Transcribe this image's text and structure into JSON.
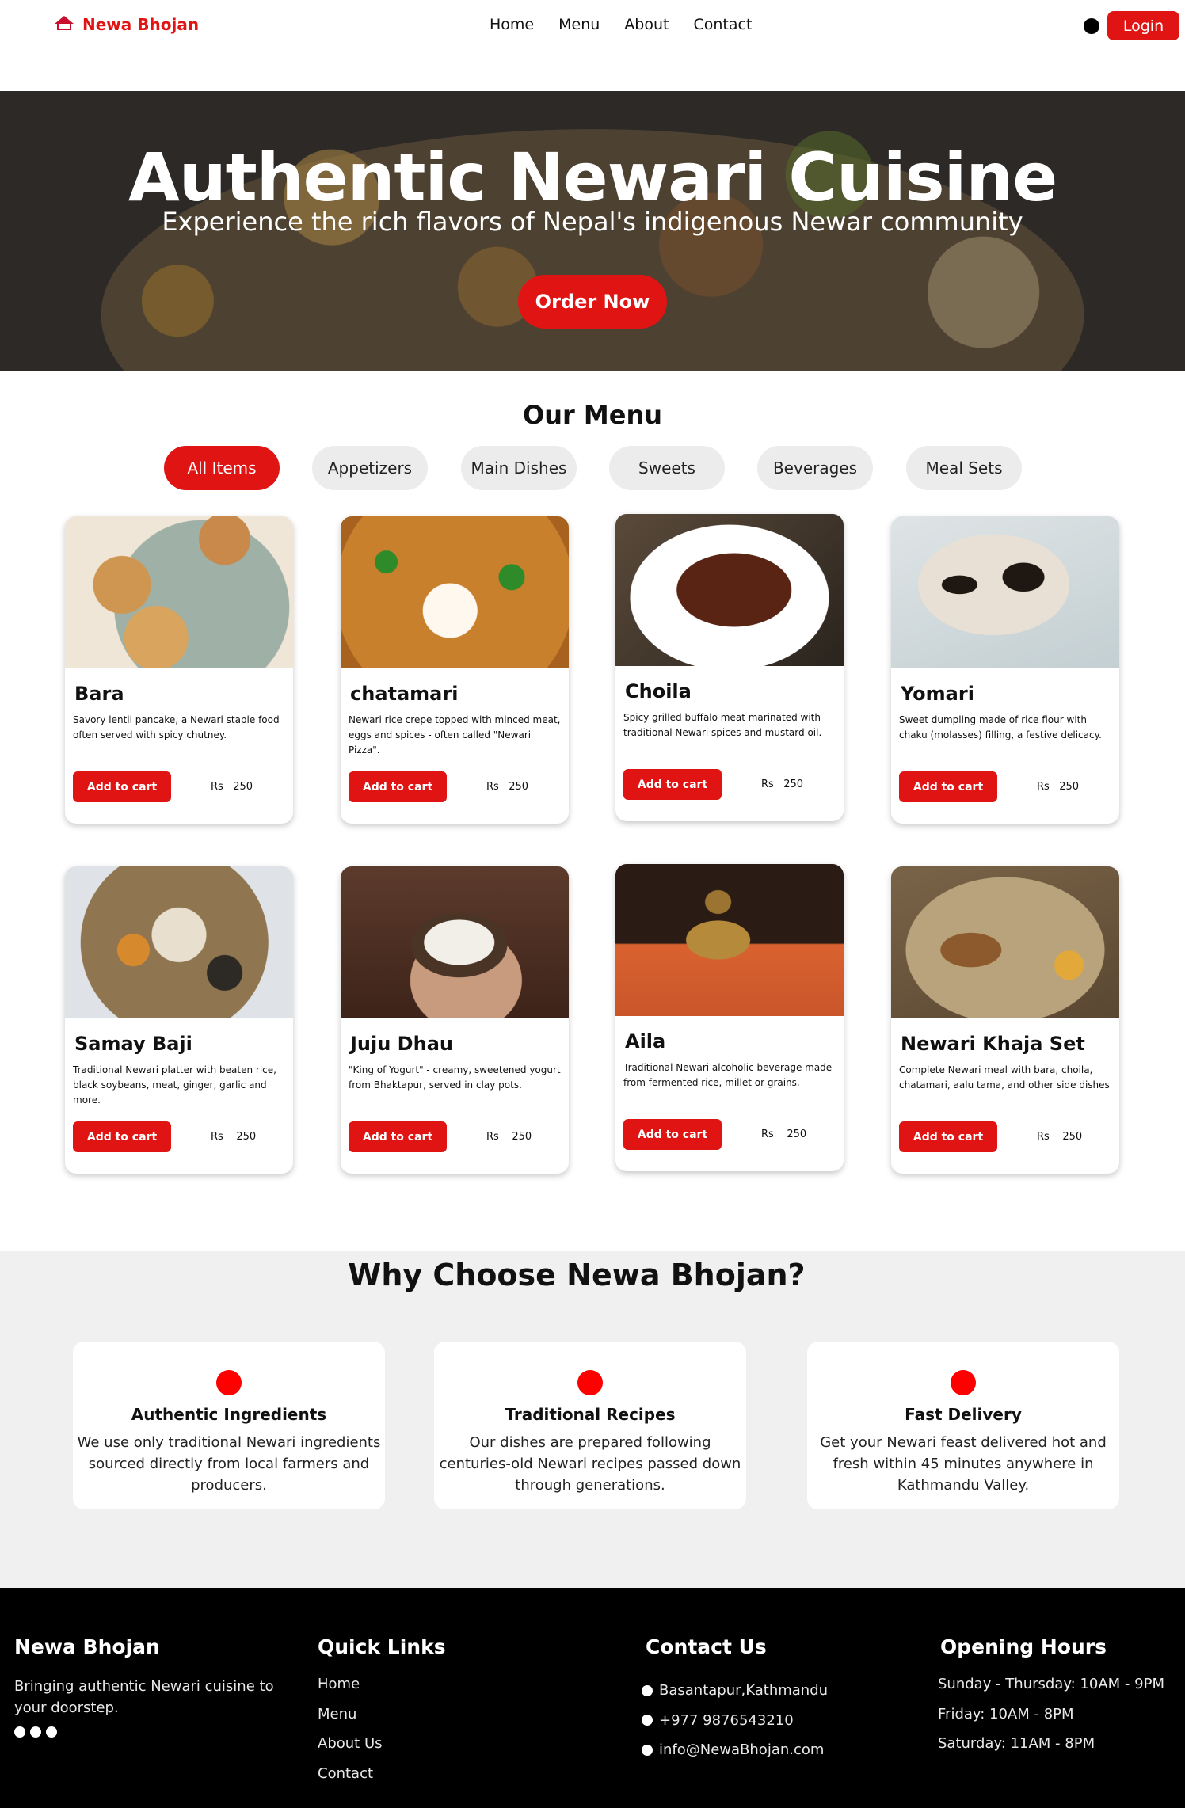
{
  "nav": {
    "brand": "Newa Bhojan",
    "links": [
      "Home",
      "Menu",
      "About",
      "Contact"
    ],
    "login": "Login"
  },
  "hero": {
    "title": "Authentic Newari Cuisine",
    "subtitle": "Experience the rich flavors of Nepal's indigenous Newar community",
    "cta": "Order Now"
  },
  "menu": {
    "title": "Our Menu",
    "filters": [
      "All Items",
      "Appetizers",
      "Main Dishes",
      "Sweets",
      "Beverages",
      "Meal Sets"
    ],
    "active_filter": "All Items",
    "add_label": "Add to cart",
    "items": [
      {
        "name": "Bara",
        "desc": "Savory lentil pancake, a Newari staple food often served with spicy chutney.",
        "price": "Rs   250"
      },
      {
        "name": "chatamari",
        "desc": "Newari rice crepe topped with minced meat, eggs and spices - often called \"Newari Pizza\".",
        "price": "Rs   250"
      },
      {
        "name": "Choila",
        "desc": "Spicy grilled buffalo meat marinated with traditional Newari spices and mustard oil.",
        "price": "Rs   250"
      },
      {
        "name": "Yomari",
        "desc": "Sweet dumpling made of rice flour with chaku (molasses) filling, a festive delicacy.",
        "price": "Rs   250"
      },
      {
        "name": "Samay Baji",
        "desc": "Traditional Newari platter with beaten rice, black soybeans, meat, ginger, garlic and more.",
        "price": "Rs    250"
      },
      {
        "name": "Juju Dhau",
        "desc": "\"King of Yogurt\" - creamy, sweetened yogurt from Bhaktapur, served in clay pots.",
        "price": "Rs    250"
      },
      {
        "name": "Aila",
        "desc": "Traditional Newari alcoholic beverage made from fermented rice, millet or grains.",
        "price": "Rs    250"
      },
      {
        "name": "Newari Khaja Set",
        "desc": "Complete Newari meal with bara, choila, chatamari, aalu tama, and other side dishes",
        "price": "Rs    250"
      }
    ]
  },
  "why": {
    "title": "Why Choose Newa Bhojan?",
    "features": [
      {
        "title": "Authentic Ingredients",
        "text": "We use only traditional Newari ingredients sourced directly from local farmers and producers."
      },
      {
        "title": "Traditional Recipes",
        "text": "Our dishes are prepared following centuries-old Newari recipes passed down through generations."
      },
      {
        "title": "Fast Delivery",
        "text": "Get your Newari feast delivered hot and fresh within 45 minutes anywhere in Kathmandu Valley."
      }
    ]
  },
  "footer": {
    "brand": "Newa Bhojan",
    "tagline": "Bringing authentic Newari cuisine to your doorstep.",
    "quick_title": "Quick Links",
    "quick_links": [
      "Home",
      "Menu",
      "About Us",
      "Contact"
    ],
    "contact_title": "Contact Us",
    "contact": [
      "Basantapur,Kathmandu",
      "+977 9876543210",
      "info@NewaBhojan.com"
    ],
    "hours_title": "Opening Hours",
    "hours": [
      "Sunday - Thursday: 10AM - 9PM",
      "Friday: 10AM - 8PM",
      "Saturday: 11AM - 8PM"
    ]
  },
  "colors": {
    "accent": "#e11414",
    "section_bg": "#f0f0f0",
    "footer_bg": "#000000"
  }
}
